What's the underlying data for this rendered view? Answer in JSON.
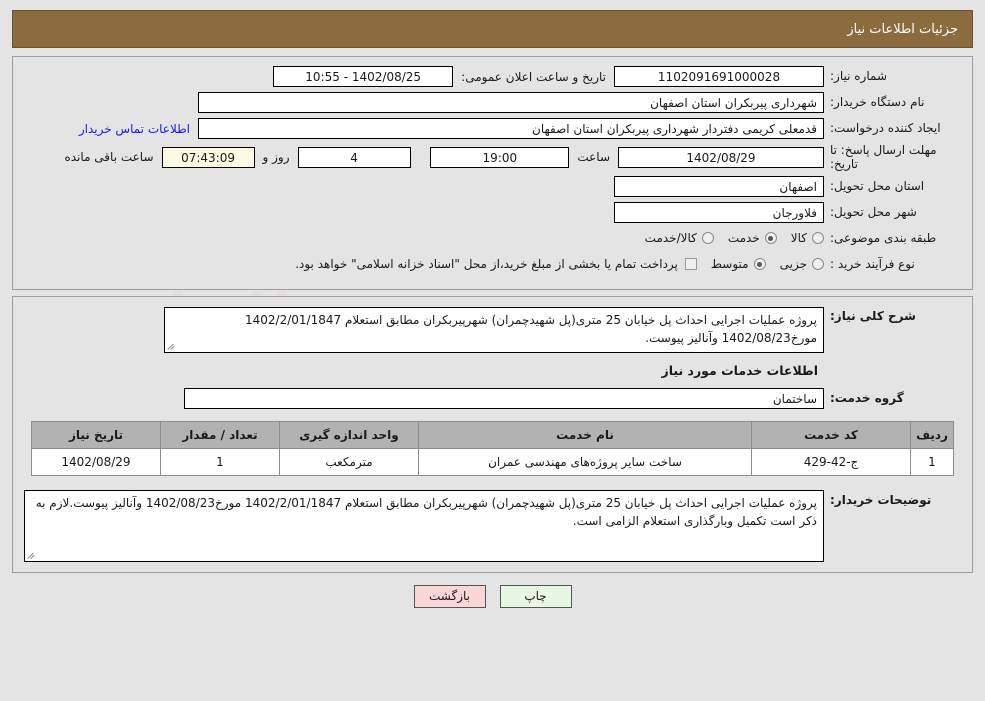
{
  "header": {
    "title": "جزئیات اطلاعات نیاز",
    "bar_color": "#8c6b3f"
  },
  "watermark": {
    "brand": "AriaTender",
    "suffix": ".net",
    "shield_label": "shield-icon"
  },
  "summary": {
    "need_number_label": "شماره نیاز:",
    "need_number_value": "1102091691000028",
    "public_announce_label": "تاریخ و ساعت اعلان عمومی:",
    "public_announce_value": "1402/08/25 - 10:55",
    "buyer_org_label": "نام دستگاه خریدار:",
    "buyer_org_value": "شهرداری پیربکران استان اصفهان",
    "requester_label": "ایجاد کننده درخواست:",
    "requester_value": "قدمعلی کریمی دفتردار شهرداری پیربکران استان اصفهان",
    "contact_link": "اطلاعات تماس خریدار",
    "deadline_label": "مهلت ارسال پاسخ: تا تاریخ:",
    "deadline_date": "1402/08/29",
    "hour_label": "ساعت",
    "deadline_time": "19:00",
    "days_remaining": "4",
    "days_label": "روز و",
    "clock_remaining": "07:43:09",
    "remaining_suffix": "ساعت باقی مانده",
    "province_label": "استان محل تحویل:",
    "province_value": "اصفهان",
    "city_label": "شهر محل تحویل:",
    "city_value": "فلاورجان",
    "category_label": "طبقه بندی موضوعی:",
    "category_options": [
      {
        "label": "کالا",
        "selected": false
      },
      {
        "label": "خدمت",
        "selected": true
      },
      {
        "label": "کالا/خدمت",
        "selected": false
      }
    ],
    "process_label": "نوع فرآیند خرید :",
    "process_options": [
      {
        "label": "جزیی",
        "selected": false
      },
      {
        "label": "متوسط",
        "selected": true
      }
    ],
    "treasury_checked": false,
    "treasury_note": "پرداخت تمام یا بخشی از مبلغ خرید،از محل \"اسناد خزانه اسلامی\" خواهد بود."
  },
  "details": {
    "general_desc_label": "شرح کلی نیاز:",
    "general_desc_value": "پروژه عملیات اجرایی احداث پل خیابان 25 متری(پل شهیدچمران) شهرپیربکران مطابق استعلام 1402/2/01/1847 مورخ1402/08/23 وآنالیز پیوست.",
    "services_section_title": "اطلاعات خدمات مورد نیاز",
    "service_group_label": "گروه خدمت:",
    "service_group_value": "ساختمان",
    "table": {
      "columns": [
        "ردیف",
        "کد خدمت",
        "نام خدمت",
        "واحد اندازه گیری",
        "تعداد / مقدار",
        "تاریخ نیاز"
      ],
      "rows": [
        {
          "radif": "1",
          "code": "ج-42-429",
          "name": "ساخت سایر پروژه‌های مهندسی عمران",
          "unit": "مترمکعب",
          "qty": "1",
          "date": "1402/08/29"
        }
      ]
    },
    "buyer_notes_label": "توضیحات خریدار:",
    "buyer_notes_value": "پروژه عملیات اجرایی احداث پل خیابان 25 متری(پل شهیدچمران) شهرپیربکران مطابق استعلام 1402/2/01/1847 مورخ1402/08/23 وآنالیز پیوست.لازم به ذکر است تکمیل وبارگذاری استعلام الزامی است."
  },
  "footer": {
    "back_label": "بازگشت",
    "print_label": "چاپ"
  }
}
